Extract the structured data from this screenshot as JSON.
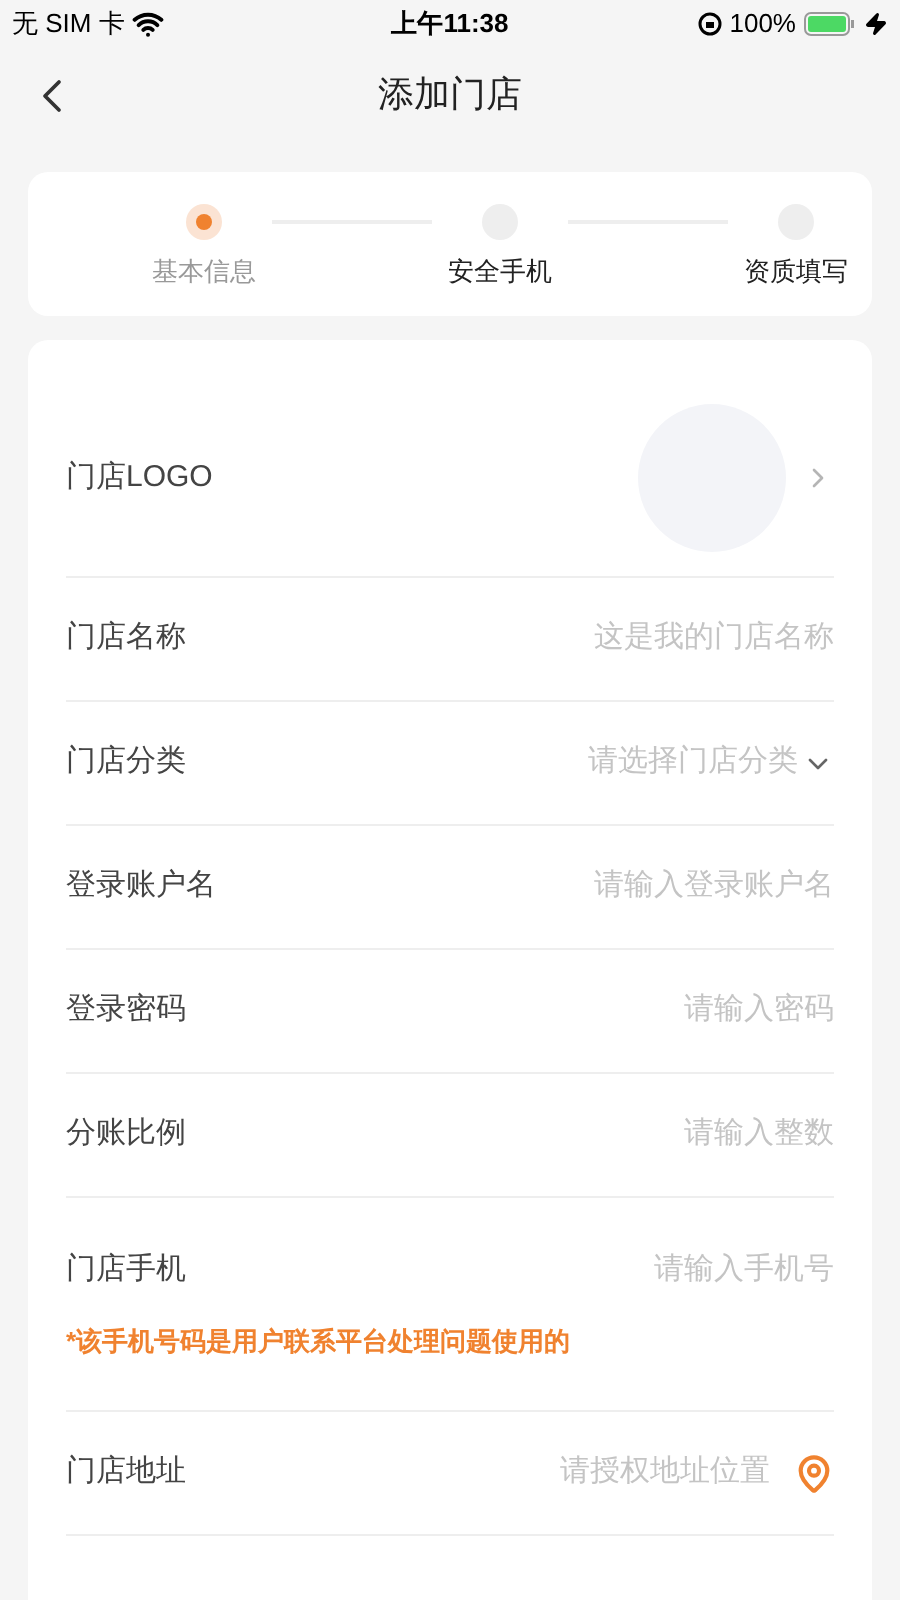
{
  "status_bar": {
    "carrier": "无 SIM 卡",
    "time": "上午11:38",
    "battery": "100%"
  },
  "nav": {
    "title": "添加门店"
  },
  "steps": [
    {
      "label": "基本信息",
      "selected": true
    },
    {
      "label": "安全手机",
      "selected": false
    },
    {
      "label": "资质填写",
      "selected": false
    }
  ],
  "form": [
    {
      "kind": "logo",
      "label": "门店LOGO"
    },
    {
      "kind": "input",
      "label": "门店名称",
      "placeholder": "这是我的门店名称"
    },
    {
      "kind": "select",
      "label": "门店分类",
      "placeholder": "请选择门店分类"
    },
    {
      "kind": "input",
      "label": "登录账户名",
      "placeholder": "请输入登录账户名"
    },
    {
      "kind": "input",
      "label": "登录密码",
      "placeholder": "请输入密码"
    },
    {
      "kind": "input",
      "label": "分账比例",
      "placeholder": "请输入整数"
    },
    {
      "kind": "input",
      "label": "门店手机",
      "placeholder": "请输入手机号",
      "note": "*该手机号码是用户联系平台处理问题使用的"
    },
    {
      "kind": "location",
      "label": "门店地址",
      "placeholder": "请授权地址位置"
    }
  ]
}
